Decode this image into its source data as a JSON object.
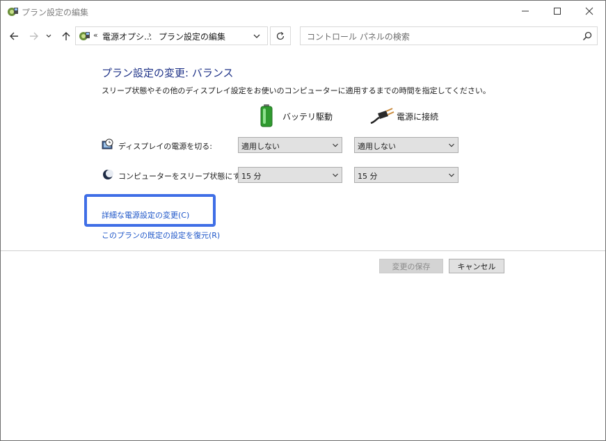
{
  "window": {
    "title": "プラン設定の編集",
    "icon": "power-options-icon"
  },
  "address": {
    "chevron": "«",
    "crumb1": "電源オプシ...",
    "separator": "›",
    "crumb2": "プラン設定の編集"
  },
  "search": {
    "placeholder": "コントロール パネルの検索"
  },
  "main": {
    "heading": "プラン設定の変更: バランス",
    "description": "スリープ状態やその他のディスプレイ設定をお使いのコンピューターに適用するまでの時間を指定してください。",
    "columns": {
      "battery": "バッテリ駆動",
      "plugged": "電源に接続"
    },
    "rows": [
      {
        "label": "ディスプレイの電源を切る:",
        "battery_value": "適用しない",
        "plugged_value": "適用しない",
        "icon": "display-clock-icon"
      },
      {
        "label": "コンピューターをスリープ状態にする:",
        "battery_value": "15 分",
        "plugged_value": "15 分",
        "icon": "moon-sleep-icon"
      }
    ],
    "links": {
      "advanced": "詳細な電源設定の変更(C)",
      "restore": "このプランの既定の設定を復元(R)"
    }
  },
  "footer": {
    "save": "変更の保存",
    "cancel": "キャンセル"
  },
  "colors": {
    "heading": "#1e3287",
    "link": "#1e56c8",
    "highlight": "#3f6ee6"
  }
}
